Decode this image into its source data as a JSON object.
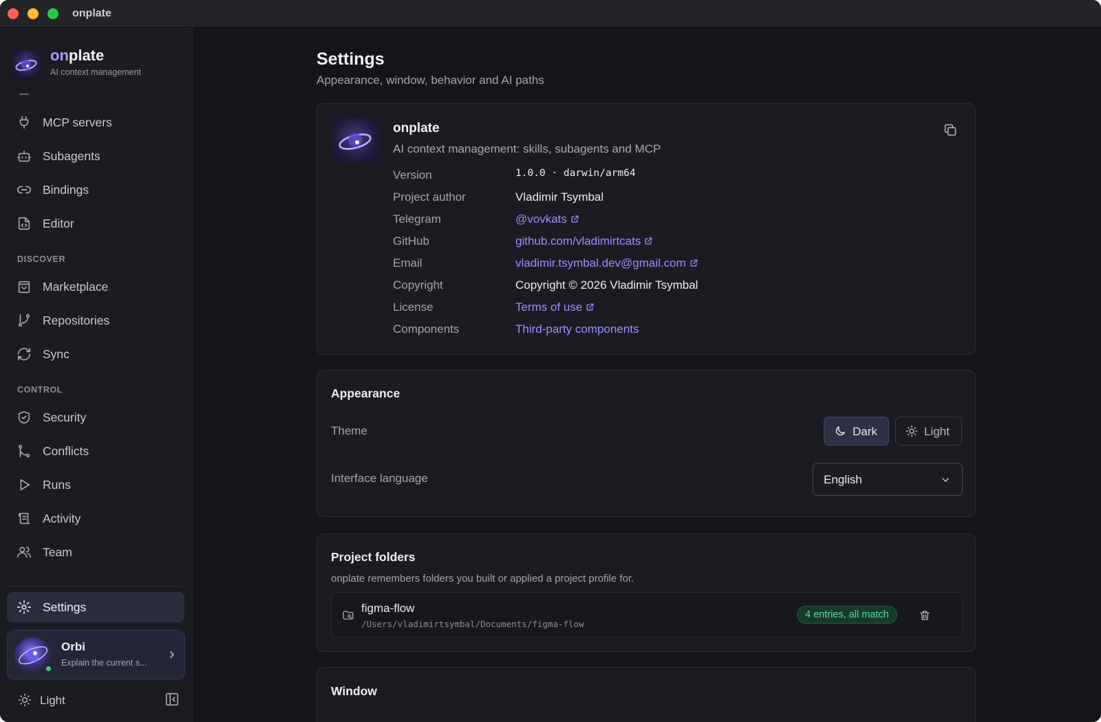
{
  "app": {
    "window_title": "onplate"
  },
  "brand": {
    "name_prefix": "on",
    "name_suffix": "plate",
    "subtitle": "AI context management"
  },
  "sidebar": {
    "items_top": [
      {
        "label": "MCP servers",
        "icon": "plug-icon"
      },
      {
        "label": "Subagents",
        "icon": "bot-icon"
      },
      {
        "label": "Bindings",
        "icon": "link-icon"
      },
      {
        "label": "Editor",
        "icon": "file-code-icon"
      }
    ],
    "discover_label": "DISCOVER",
    "items_discover": [
      {
        "label": "Marketplace",
        "icon": "shopping-bag-icon"
      },
      {
        "label": "Repositories",
        "icon": "git-branch-icon"
      },
      {
        "label": "Sync",
        "icon": "refresh-icon"
      }
    ],
    "control_label": "CONTROL",
    "items_control": [
      {
        "label": "Security",
        "icon": "shield-check-icon"
      },
      {
        "label": "Conflicts",
        "icon": "git-merge-icon"
      },
      {
        "label": "Runs",
        "icon": "play-icon"
      },
      {
        "label": "Activity",
        "icon": "scroll-icon"
      },
      {
        "label": "Team",
        "icon": "users-icon"
      }
    ],
    "settings": {
      "label": "Settings",
      "icon": "gear-icon",
      "active": true
    },
    "orbi": {
      "name": "Orbi",
      "subtitle": "Explain the current s..."
    },
    "theme_toggle": {
      "label": "Light",
      "icon": "sun-icon"
    }
  },
  "page": {
    "title": "Settings",
    "subtitle": "Appearance, window, behavior and AI paths"
  },
  "about": {
    "name": "onplate",
    "description": "AI context management: skills, subagents and MCP",
    "rows": {
      "version": {
        "key": "Version",
        "value": "1.0.0 · darwin/arm64"
      },
      "author": {
        "key": "Project author",
        "value": "Vladimir Tsymbal"
      },
      "telegram": {
        "key": "Telegram",
        "value": "@vovkats"
      },
      "github": {
        "key": "GitHub",
        "value": "github.com/vladimirtcats"
      },
      "email": {
        "key": "Email",
        "value": "vladimir.tsymbal.dev@gmail.com"
      },
      "copyright": {
        "key": "Copyright",
        "value": "Copyright © 2026 Vladimir Tsymbal"
      },
      "license": {
        "key": "License",
        "value": "Terms of use"
      },
      "components": {
        "key": "Components",
        "value": "Third-party components"
      }
    }
  },
  "appearance": {
    "title": "Appearance",
    "theme_label": "Theme",
    "theme_dark": "Dark",
    "theme_light": "Light",
    "theme_selected": "Dark",
    "language_label": "Interface language",
    "language_value": "English"
  },
  "project_folders": {
    "title": "Project folders",
    "subtitle": "onplate remembers folders you built or applied a project profile for.",
    "folders": [
      {
        "name": "figma-flow",
        "path": "/Users/vladimirtsymbal/Documents/figma-flow",
        "status": "4 entries, all match"
      }
    ]
  },
  "window_section": {
    "title": "Window"
  },
  "colors": {
    "accent": "#9c8fff",
    "background": "#141519",
    "sidebar": "#1b1c21",
    "success": "#5fd69a"
  }
}
